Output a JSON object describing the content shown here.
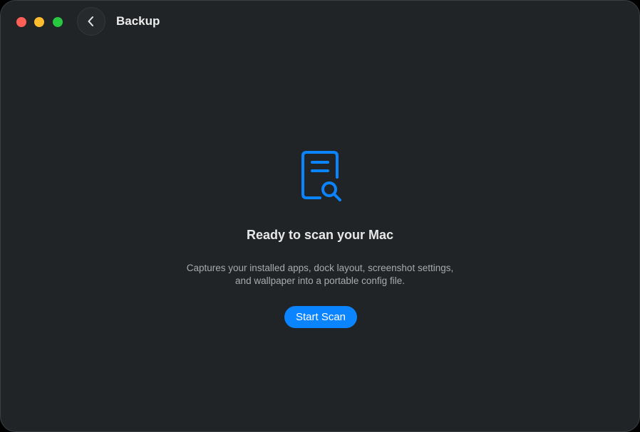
{
  "window": {
    "title": "Backup",
    "controls": [
      "close",
      "minimize",
      "zoom"
    ]
  },
  "toolbar": {
    "back_icon": "chevron-left-icon"
  },
  "empty_state": {
    "icon": "document-search-icon",
    "headline": "Ready to scan your Mac",
    "description_line1": "Captures your installed apps, dock layout, screenshot settings,",
    "description_line2": "and wallpaper into a portable config file.",
    "button_label": "Start Scan"
  },
  "colors": {
    "accent": "#0a84ff",
    "background": "#212426",
    "close": "#ff5f57",
    "minimize": "#febc2e",
    "zoom": "#28c840"
  }
}
